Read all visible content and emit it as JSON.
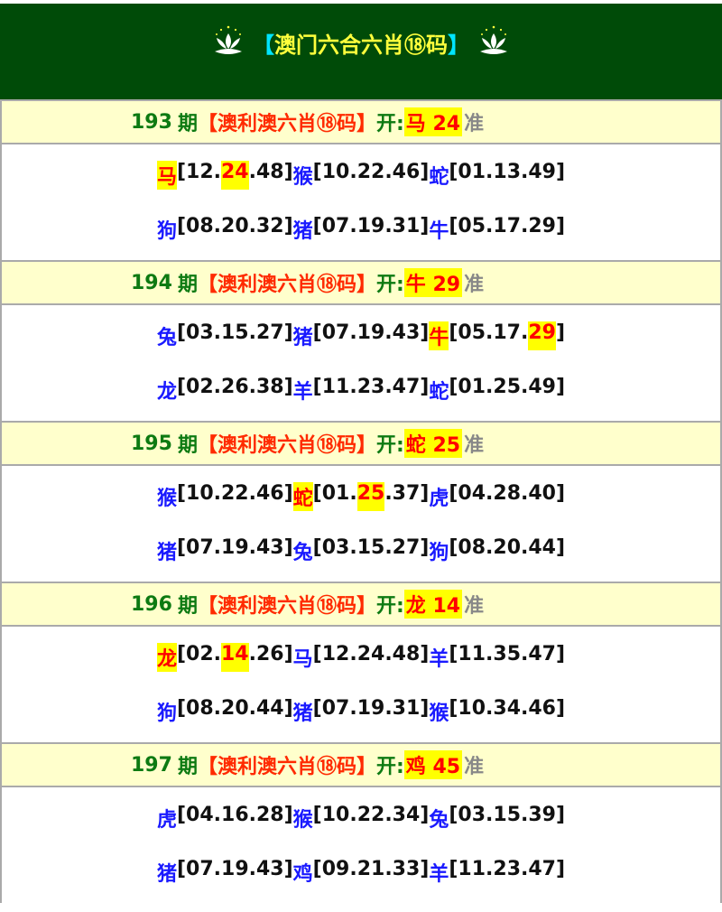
{
  "header": {
    "title_left_bracket": "【",
    "title_text": "澳门六合六肖⑱码",
    "title_right_bracket": "】"
  },
  "periods": [
    {
      "issue": "193",
      "qi": "期",
      "name": "【澳利澳六肖⑱码】",
      "kai": "开:",
      "result": "马 24",
      "zhun": "准",
      "rows": [
        [
          {
            "animal": "马",
            "pre": "[12.",
            "hit": "24",
            "post": ".48]",
            "animal_hit": true
          },
          {
            "animal": "猴",
            "pre": "[10.22.46]",
            "hit": "",
            "post": "",
            "animal_hit": false
          },
          {
            "animal": "蛇",
            "pre": "[01.13.49]",
            "hit": "",
            "post": "",
            "animal_hit": false
          }
        ],
        [
          {
            "animal": "狗",
            "pre": "[08.20.32]",
            "hit": "",
            "post": "",
            "animal_hit": false
          },
          {
            "animal": "猪",
            "pre": "[07.19.31]",
            "hit": "",
            "post": "",
            "animal_hit": false
          },
          {
            "animal": "牛",
            "pre": "[05.17.29]",
            "hit": "",
            "post": "",
            "animal_hit": false
          }
        ]
      ]
    },
    {
      "issue": "194",
      "qi": "期",
      "name": "【澳利澳六肖⑱码】",
      "kai": "开:",
      "result": "牛 29",
      "zhun": "准",
      "rows": [
        [
          {
            "animal": "兔",
            "pre": "[03.15.27]",
            "hit": "",
            "post": "",
            "animal_hit": false
          },
          {
            "animal": "猪",
            "pre": "[07.19.43]",
            "hit": "",
            "post": "",
            "animal_hit": false
          },
          {
            "animal": "牛",
            "pre": "[05.17.",
            "hit": "29",
            "post": "]",
            "animal_hit": true
          }
        ],
        [
          {
            "animal": "龙",
            "pre": "[02.26.38]",
            "hit": "",
            "post": "",
            "animal_hit": false
          },
          {
            "animal": "羊",
            "pre": "[11.23.47]",
            "hit": "",
            "post": "",
            "animal_hit": false
          },
          {
            "animal": "蛇",
            "pre": "[01.25.49]",
            "hit": "",
            "post": "",
            "animal_hit": false
          }
        ]
      ]
    },
    {
      "issue": "195",
      "qi": "期",
      "name": "【澳利澳六肖⑱码】",
      "kai": "开:",
      "result": "蛇 25",
      "zhun": "准",
      "rows": [
        [
          {
            "animal": "猴",
            "pre": "[10.22.46]",
            "hit": "",
            "post": "",
            "animal_hit": false
          },
          {
            "animal": "蛇",
            "pre": "[01.",
            "hit": "25",
            "post": ".37]",
            "animal_hit": true
          },
          {
            "animal": "虎",
            "pre": "[04.28.40]",
            "hit": "",
            "post": "",
            "animal_hit": false
          }
        ],
        [
          {
            "animal": "猪",
            "pre": "[07.19.43]",
            "hit": "",
            "post": "",
            "animal_hit": false
          },
          {
            "animal": "兔",
            "pre": "[03.15.27]",
            "hit": "",
            "post": "",
            "animal_hit": false
          },
          {
            "animal": "狗",
            "pre": "[08.20.44]",
            "hit": "",
            "post": "",
            "animal_hit": false
          }
        ]
      ]
    },
    {
      "issue": "196",
      "qi": "期",
      "name": "【澳利澳六肖⑱码】",
      "kai": "开:",
      "result": "龙 14",
      "zhun": "准",
      "rows": [
        [
          {
            "animal": "龙",
            "pre": "[02.",
            "hit": "14",
            "post": ".26]",
            "animal_hit": true
          },
          {
            "animal": "马",
            "pre": "[12.24.48]",
            "hit": "",
            "post": "",
            "animal_hit": false
          },
          {
            "animal": "羊",
            "pre": "[11.35.47]",
            "hit": "",
            "post": "",
            "animal_hit": false
          }
        ],
        [
          {
            "animal": "狗",
            "pre": "[08.20.44]",
            "hit": "",
            "post": "",
            "animal_hit": false
          },
          {
            "animal": "猪",
            "pre": "[07.19.31]",
            "hit": "",
            "post": "",
            "animal_hit": false
          },
          {
            "animal": "猴",
            "pre": "[10.34.46]",
            "hit": "",
            "post": "",
            "animal_hit": false
          }
        ]
      ]
    },
    {
      "issue": "197",
      "qi": "期",
      "name": "【澳利澳六肖⑱码】",
      "kai": "开:",
      "result": "鸡 45",
      "zhun": "准",
      "rows": [
        [
          {
            "animal": "虎",
            "pre": "[04.16.28]",
            "hit": "",
            "post": "",
            "animal_hit": false
          },
          {
            "animal": "猴",
            "pre": "[10.22.34]",
            "hit": "",
            "post": "",
            "animal_hit": false
          },
          {
            "animal": "兔",
            "pre": "[03.15.39]",
            "hit": "",
            "post": "",
            "animal_hit": false
          }
        ],
        [
          {
            "animal": "猪",
            "pre": "[07.19.43]",
            "hit": "",
            "post": "",
            "animal_hit": false
          },
          {
            "animal": "鸡",
            "pre": "[09.21.33]",
            "hit": "",
            "post": "",
            "animal_hit": false
          },
          {
            "animal": "羊",
            "pre": "[11.23.47]",
            "hit": "",
            "post": "",
            "animal_hit": false
          }
        ]
      ]
    }
  ],
  "colors": {
    "header_bg": "#004b08",
    "title": "#ffff3c",
    "period_head_bg": "#ffffcc",
    "highlight": "#ffff00",
    "red": "#ff0000",
    "blue": "#1a1aff",
    "green": "#0d7a12"
  },
  "icons": {
    "emblem": "lotus-emblem-icon"
  }
}
